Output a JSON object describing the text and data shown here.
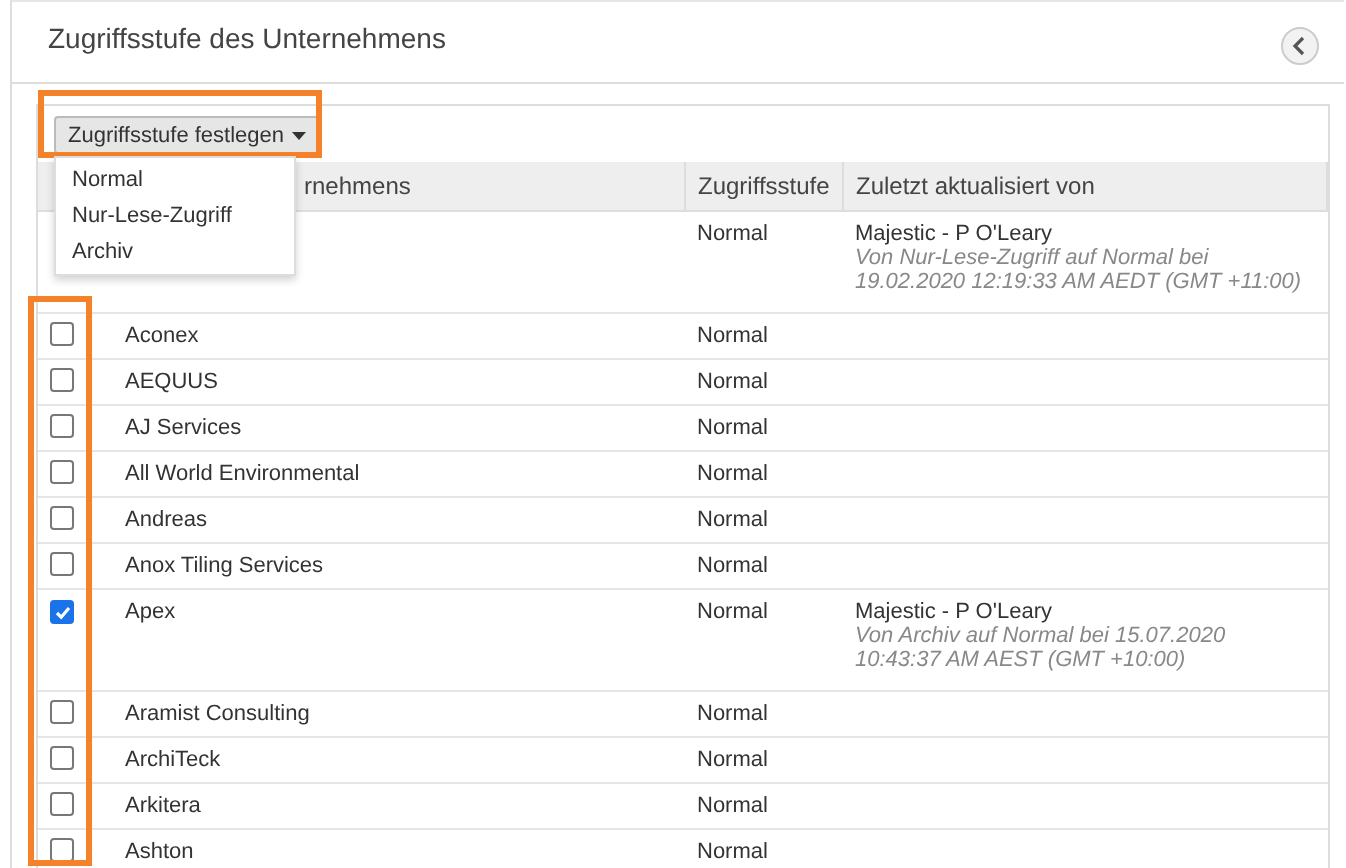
{
  "header": {
    "title": "Zugriffsstufe des Unternehmens"
  },
  "toolbar": {
    "button": "Zugriffsstufe festlegen",
    "expanded": true,
    "menu": [
      {
        "label": "Normal"
      },
      {
        "label": "Nur-Lese-Zugriff"
      },
      {
        "label": "Archiv"
      }
    ]
  },
  "table": {
    "columns": [
      "rnehmens",
      "Zugriffsstufe",
      "Zuletzt aktualisiert von"
    ],
    "rows": [
      {
        "level": "Normal",
        "updated_by": "Majestic - P O'Leary",
        "change": "Von Nur-Lese-Zugriff auf Normal bei 19.02.2020 12:19:33 AM AEDT (GMT +11:00)"
      },
      {
        "name": "Aconex",
        "checked": false,
        "level": "Normal"
      },
      {
        "name": "AEQUUS",
        "checked": false,
        "level": "Normal"
      },
      {
        "name": "AJ Services",
        "checked": false,
        "level": "Normal"
      },
      {
        "name": "All World Environmental",
        "checked": false,
        "level": "Normal"
      },
      {
        "name": "Andreas",
        "checked": false,
        "level": "Normal"
      },
      {
        "name": "Anox Tiling Services",
        "checked": false,
        "level": "Normal"
      },
      {
        "name": "Apex",
        "checked": true,
        "level": "Normal",
        "updated_by": "Majestic - P O'Leary",
        "change": "Von Archiv auf Normal bei 15.07.2020 10:43:37 AM AEST (GMT +10:00)"
      },
      {
        "name": "Aramist Consulting",
        "checked": false,
        "level": "Normal"
      },
      {
        "name": "ArchiTeck",
        "checked": false,
        "level": "Normal"
      },
      {
        "name": "Arkitera",
        "checked": false,
        "level": "Normal"
      },
      {
        "name": "Ashton",
        "checked": false,
        "level": "Normal"
      }
    ]
  }
}
